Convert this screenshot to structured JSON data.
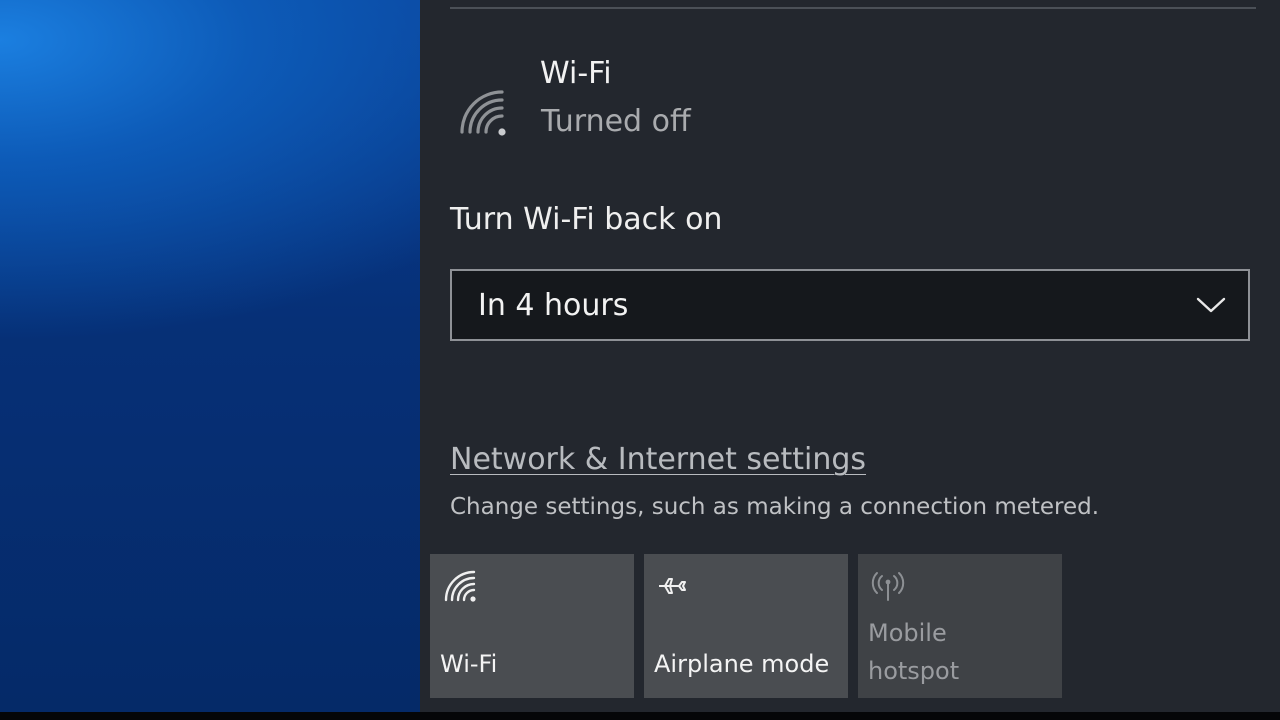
{
  "wifi": {
    "title": "Wi-Fi",
    "status": "Turned off"
  },
  "turn_back_on": {
    "label": "Turn Wi-Fi back on",
    "selected": "In 4 hours"
  },
  "settings": {
    "link": "Network & Internet settings",
    "description": "Change settings, such as making a connection metered."
  },
  "quick_actions": [
    {
      "label": "Wi-Fi",
      "icon": "wifi-icon",
      "enabled": true
    },
    {
      "label": "Airplane mode",
      "icon": "airplane-icon",
      "enabled": true
    },
    {
      "label_line1": "Mobile",
      "label_line2": "hotspot",
      "icon": "hotspot-icon",
      "enabled": false
    }
  ],
  "colors": {
    "panel": "#23272e",
    "tile": "#4a4d51",
    "desktop_accent": "#1b7fe0"
  }
}
